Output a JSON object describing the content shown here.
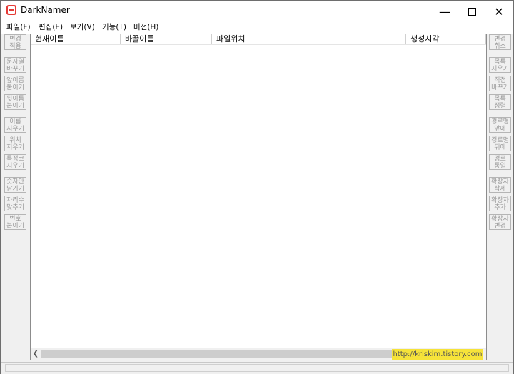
{
  "window": {
    "title": "DarkNamer"
  },
  "menu": [
    "파일(F)",
    "편집(E)",
    "보기(V)",
    "기능(T)",
    "버전(H)"
  ],
  "columns": [
    "현재이름",
    "바꿀이름",
    "파일위치",
    "생성시각"
  ],
  "left_buttons": [
    [
      "변경",
      "적용"
    ],
    [
      "문자열",
      "바꾸기"
    ],
    [
      "앞이름",
      "붙이기"
    ],
    [
      "뒷이름",
      "붙이기"
    ],
    [
      "이름",
      "지우기"
    ],
    [
      "위치",
      "지우기"
    ],
    [
      "특정코",
      "지우기"
    ],
    [
      "숫자만",
      "남기기"
    ],
    [
      "자리수",
      "맞추기"
    ],
    [
      "번호",
      "붙이기"
    ]
  ],
  "right_buttons": [
    [
      "변경",
      "취소"
    ],
    [
      "목록",
      "지우기"
    ],
    [
      "직접",
      "바꾸기"
    ],
    [
      "목록",
      "정렬"
    ],
    [
      "경로명",
      "앞에"
    ],
    [
      "경로명",
      "뒤에"
    ],
    [
      "경로",
      "통일"
    ],
    [
      "확장자",
      "삭제"
    ],
    [
      "확장자",
      "추가"
    ],
    [
      "확장자",
      "변경"
    ]
  ],
  "watermark": "http://kriskim.tistory.com",
  "icons": [
    "app-icon",
    "minimize-icon",
    "maximize-icon",
    "close-icon",
    "scroll-left-icon",
    "scroll-right-icon"
  ]
}
